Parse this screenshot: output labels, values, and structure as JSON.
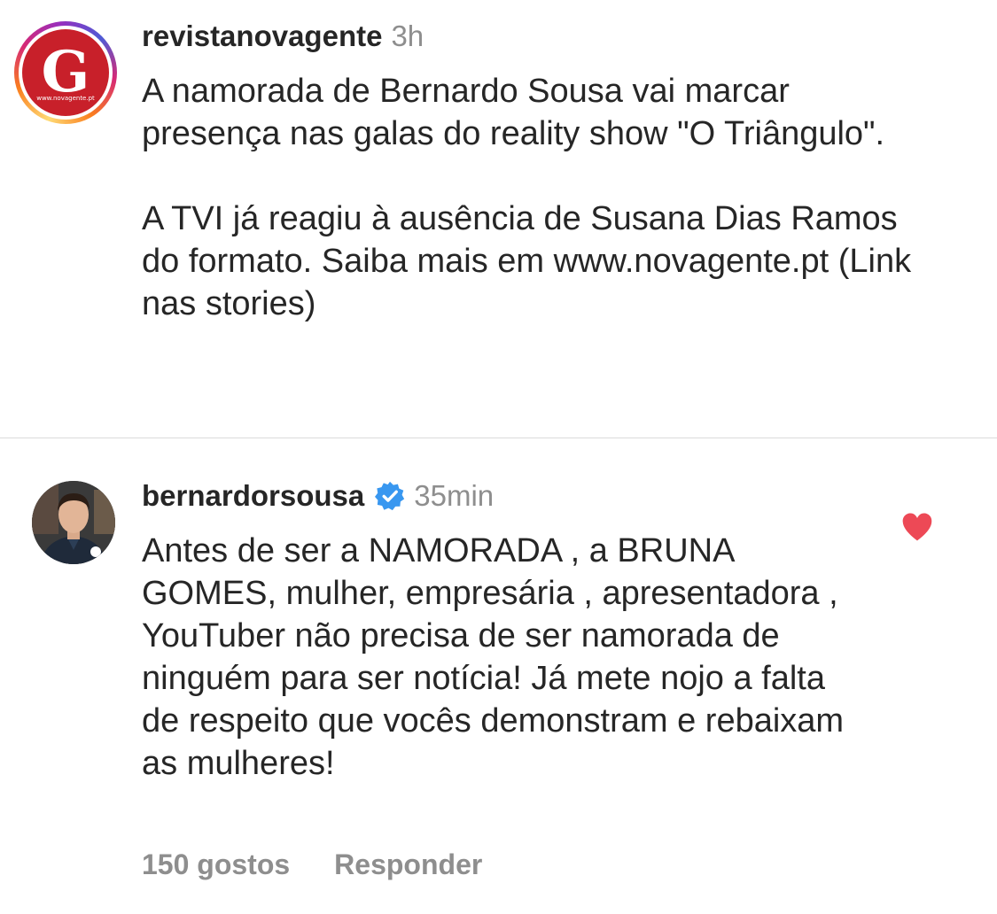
{
  "post": {
    "username": "revistanovagente",
    "time": "3h",
    "paragraphs": [
      "A namorada de Bernardo Sousa vai marcar presença nas galas do reality show \"O Triângulo\".",
      "A TVI já reagiu à ausência de Susana Dias Ramos do formato. Saiba mais em www.novagente.pt (Link nas stories)"
    ],
    "avatar": {
      "logo_letter": "G",
      "logo_url": "www.novagente.pt",
      "brand_color": "#c8202a"
    }
  },
  "comment": {
    "username": "bernardorsousa",
    "verified": true,
    "time": "35min",
    "text": "Antes de ser a NAMORADA , a BRUNA GOMES, mulher, empresária , apresentadora , YouTuber não precisa de ser namorada de ninguém para ser notícia! Já mete nojo a falta de respeito que vocês demonstram e rebaixam as mulheres!",
    "likes_label": "150 gostos",
    "reply_label": "Responder",
    "liked": true,
    "heart_color": "#ed4956",
    "verified_color": "#3897f0"
  }
}
